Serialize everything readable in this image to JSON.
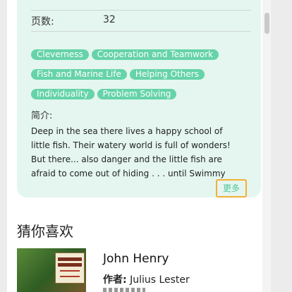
{
  "book": {
    "pages_label": "页数:",
    "pages_value": "32",
    "tags": [
      "Cleverness",
      "Cooperation and Teamwork",
      "Fish and Marine Life",
      "Helping Others",
      "Individuality",
      "Problem Solving"
    ],
    "intro_label": "简介:",
    "intro_text": "Deep in the sea there lives a happy school of little fish. Their watery world is full of wonders! But there... also danger and the little fish are afraid to come out of hiding . . . until Swimmy comes along. Swimmy",
    "more_label": "更多"
  },
  "recommend": {
    "title": "猜你喜欢",
    "items": [
      {
        "title": "John Henry",
        "author_label": "作者:",
        "author": "Julius Lester",
        "cover_icon": "book-cover-image"
      }
    ]
  },
  "colors": {
    "card_bg": "#e4f6ef",
    "tag_bg": "#66d3aa",
    "accent_text": "#52c59a",
    "focus_border": "#f2b035"
  }
}
